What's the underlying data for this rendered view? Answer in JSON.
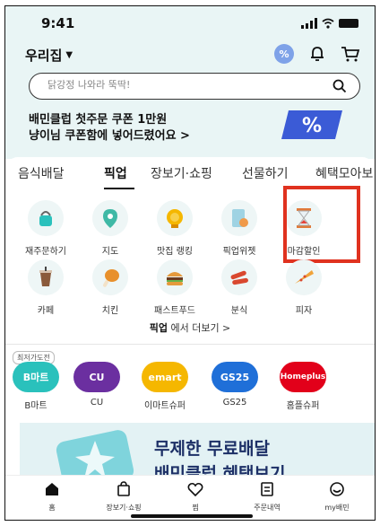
{
  "status": {
    "time": "9:41"
  },
  "header": {
    "address": "우리집",
    "coupon_badge": "%"
  },
  "search": {
    "placeholder": "닭강정 나와라 뚝딱!"
  },
  "promo": {
    "line1": "배민클럽 첫주문 쿠폰 1만원",
    "line2": "냥이님 쿠폰함에 넣어드렸어요 >",
    "art_symbol": "%"
  },
  "tabs": [
    {
      "label": "음식배달"
    },
    {
      "label": "픽업",
      "active": true
    },
    {
      "label": "장보기·쇼핑"
    },
    {
      "label": "선물하기"
    },
    {
      "label": "혜택모아보"
    }
  ],
  "categories_row1": [
    {
      "label": "재주문하기",
      "icon": "reorder-icon"
    },
    {
      "label": "지도",
      "icon": "map-pin-icon"
    },
    {
      "label": "맛집 랭킹",
      "icon": "medal-icon"
    },
    {
      "label": "픽업위젯",
      "icon": "widget-icon"
    },
    {
      "label": "마감할인",
      "icon": "hourglass-icon",
      "highlighted": true
    }
  ],
  "categories_row2": [
    {
      "label": "카페",
      "icon": "coffee-icon"
    },
    {
      "label": "치킨",
      "icon": "chicken-icon"
    },
    {
      "label": "패스트푸드",
      "icon": "burger-icon"
    },
    {
      "label": "분식",
      "icon": "sausage-icon"
    },
    {
      "label": "피자",
      "icon": "pizza-icon"
    }
  ],
  "more": {
    "bold": "픽업",
    "rest": " 에서 더보기  >"
  },
  "stores": {
    "tag": "최저가도전",
    "items": [
      {
        "label": "B마트",
        "logo": "B마트",
        "color": "#2ac1bc"
      },
      {
        "label": "CU",
        "logo": "CU",
        "color": "#6b2fa0"
      },
      {
        "label": "이마트슈퍼",
        "logo": "emart",
        "color": "#f5b700"
      },
      {
        "label": "GS25",
        "logo": "GS25",
        "color": "#1f6fd8"
      },
      {
        "label": "홈플슈퍼",
        "logo": "Homeplus",
        "color": "#e2001a"
      }
    ]
  },
  "banner": {
    "line1": "무제한 무료배달",
    "line2": "배민클럽 혜택보기"
  },
  "bottom_nav": [
    {
      "label": "홈",
      "icon": "home-icon"
    },
    {
      "label": "장보기·쇼핑",
      "icon": "shopping-bag-icon"
    },
    {
      "label": "찜",
      "icon": "heart-icon"
    },
    {
      "label": "주문내역",
      "icon": "receipt-icon"
    },
    {
      "label": "my배민",
      "icon": "profile-icon"
    }
  ],
  "colors": {
    "accent": "#2ac1bc",
    "highlight": "#e0321f",
    "navy": "#1c2f66"
  }
}
